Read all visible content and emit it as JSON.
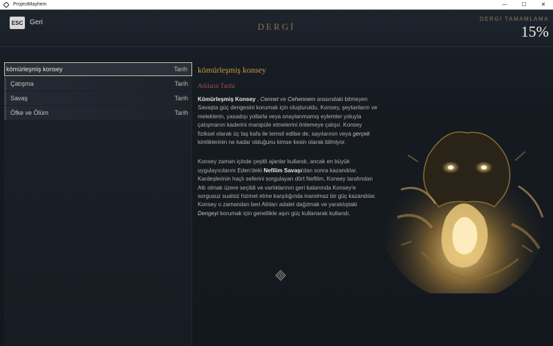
{
  "window": {
    "title": "ProjectMayhem",
    "minimize": "—",
    "maximize": "☐",
    "close": "✕"
  },
  "header": {
    "esc_key": "ESC",
    "back_label": "Geri",
    "title": "DERGİ",
    "completion_label": "DERGİ TAMAMLAMA",
    "completion_value": "15%"
  },
  "entries": [
    {
      "label": "kömürleşmiş konsey",
      "tag": "Tarih",
      "selected": true
    },
    {
      "label": "Çatışma",
      "tag": "Tarih",
      "selected": false
    },
    {
      "label": "Savaş",
      "tag": "Tarih",
      "selected": false
    },
    {
      "label": "Öfke ve Ölüm",
      "tag": "Tarih",
      "selected": false
    }
  ],
  "detail": {
    "title": "kömürleşmiş konsey",
    "subtitle": "Atlıların Tarihi",
    "p1": {
      "b1": "Kömürleşmiş Konsey",
      "t1": " , ",
      "i1": "Cennet",
      "t2": " ve ",
      "i2": "Cehennem",
      "t3": " arasındaki bitmeyen Savaşta güç dengesini korumak için oluşturuldu. Konsey, şeytanların ve meleklerin, yasadışı yollarla veya onaylanmamış eylemler yoluyla çatışmanın kaderini manipüle etmelerini önlemeye çalışır. Konsey fiziksel olarak üç taş kafa ile temsil edilse de, sayılarının veya ",
      "i3": "gerçek",
      "t4": " kimliklerinin ne kadar olduğunu kimse kesin olarak bilmiyor."
    },
    "p2": {
      "t1": "Konsey zaman içinde çeşitli ajanlar kullandı, ancak en büyük uygulayıcılarını Eden'deki ",
      "b1": "Nefilim Savaşı",
      "t2": "'dan sonra kazandılar. Kardeşlerinin haçlı seferini sorgulayan dört Nefilim, Konsey tarafından Atlı olmak üzere seçildi ve varlıklarının geri kalanında Konsey'e sorgusuz sualsiz hizmet etme karşılığında inanılmaz bir güç kazandılar. Konsey o zamandan beri Atlıları adalet dağıtmak ve yaratılıştaki ",
      "i1": "Dengeyi",
      "t3": " korumak için genellikle aşırı güç kullanarak kullandı."
    }
  },
  "colors": {
    "accent_gold": "#c79a3a",
    "subtitle_red": "#a5544a",
    "header_gold": "#8a7447"
  },
  "icons": {
    "app": "diamond-icon",
    "divider": "ornament-icon"
  }
}
